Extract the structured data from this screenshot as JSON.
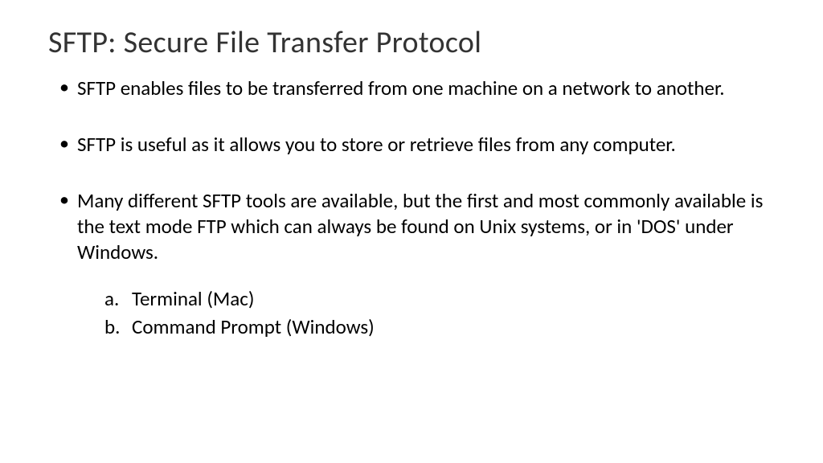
{
  "title": "SFTP: Secure File Transfer Protocol",
  "bullets": [
    "SFTP enables files to be transferred from one machine on a network to another.",
    "SFTP is useful as it allows you to store or retrieve files from any computer.",
    "Many different SFTP tools are available, but the first and most commonly available is the text mode FTP which can always be found on Unix systems, or in 'DOS' under Windows."
  ],
  "sublist": [
    "Terminal (Mac)",
    "Command Prompt (Windows)"
  ]
}
